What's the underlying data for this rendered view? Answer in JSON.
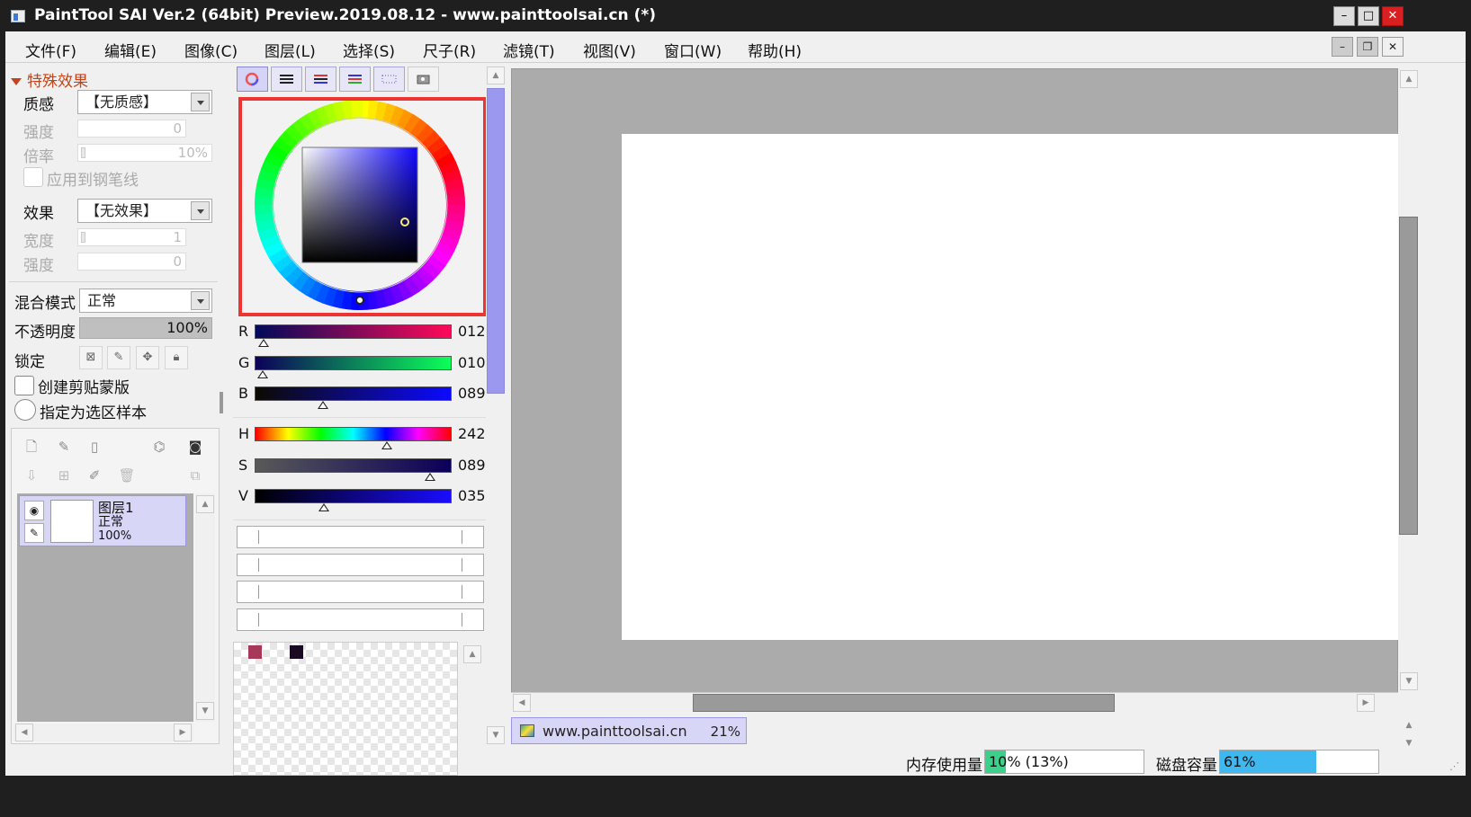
{
  "window": {
    "title": "PaintTool SAI Ver.2 (64bit) Preview.2019.08.12 - www.painttoolsai.cn (*)",
    "minimize": "–",
    "maximize": "□",
    "close": "✕"
  },
  "menu": {
    "items": [
      "文件(F)",
      "编辑(E)",
      "图像(C)",
      "图层(L)",
      "选择(S)",
      "尺子(R)",
      "滤镜(T)",
      "视图(V)",
      "窗口(W)",
      "帮助(H)"
    ],
    "mdi_minimize": "–",
    "mdi_restore": "❐",
    "mdi_close": "✕"
  },
  "effects": {
    "section_title": "特殊效果",
    "texture_label": "质感",
    "texture_value": "【无质感】",
    "strength_label": "强度",
    "strength_value": "0",
    "scale_label": "倍率",
    "scale_value": "10%",
    "apply_lines_label": "应用到钢笔线",
    "effect_label": "效果",
    "effect_value": "【无效果】",
    "width_label": "宽度",
    "width_value": "1",
    "effect_strength_label": "强度",
    "effect_strength_value": "0"
  },
  "layer_props": {
    "blend_label": "混合模式",
    "blend_value": "正常",
    "opacity_label": "不透明度",
    "opacity_value": "100%",
    "opacity_fraction": 1.0,
    "lock_label": "锁定",
    "clip_label": "创建剪贴蒙版",
    "sample_label": "指定为选区样本"
  },
  "layers": [
    {
      "name": "图层1",
      "mode": "正常",
      "opacity": "100%"
    }
  ],
  "color": {
    "channels_rgb": [
      {
        "label": "R",
        "value": "012",
        "fraction": 0.047
      },
      {
        "label": "G",
        "value": "010",
        "fraction": 0.039
      },
      {
        "label": "B",
        "value": "089",
        "fraction": 0.349
      }
    ],
    "channels_hsv": [
      {
        "label": "H",
        "value": "242",
        "fraction": 0.672
      },
      {
        "label": "S",
        "value": "089",
        "fraction": 0.89
      },
      {
        "label": "V",
        "value": "035",
        "fraction": 0.35
      }
    ],
    "current_color": "#0c0a59",
    "swatches": [
      "#a8385a",
      "#1a0a22"
    ]
  },
  "document": {
    "name": "www.painttoolsai.cn",
    "zoom": "21%"
  },
  "status": {
    "memory_label": "内存使用量",
    "memory_value": "10% (13%)",
    "memory_fraction": 0.13,
    "disk_label": "磁盘容量",
    "disk_value": "61%",
    "disk_fraction": 0.61
  },
  "colors": {
    "accent": "#9b97e4",
    "highlight_frame": "#ee3333",
    "section_title": "#c1441a",
    "memory_fill": "#3cd08a",
    "disk_fill": "#3fb8f0"
  }
}
